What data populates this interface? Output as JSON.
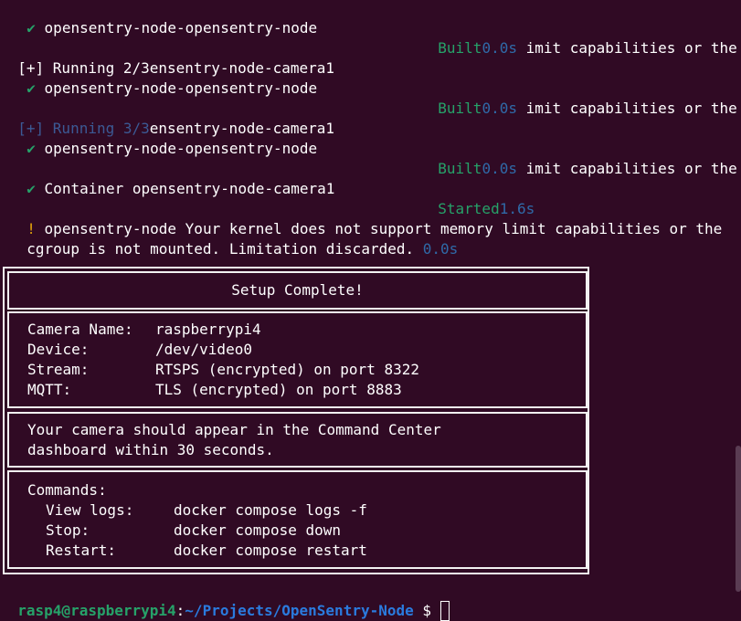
{
  "terminal": {
    "lines": [
      {
        "check": "✔",
        "text": "opensentry-node-opensentry-node"
      },
      {
        "built": "Built",
        "time": "0.0s",
        "tail": "imit capabilities or the"
      },
      {
        "prefix": "[+] Running 2/3",
        "text": "ensentry-node-camera1"
      },
      {
        "check": "✔",
        "text": "opensentry-node-opensentry-node"
      },
      {
        "built": "Built",
        "time": "0.0s",
        "tail": "imit capabilities or the"
      },
      {
        "prefix": "[+] Running 3/3",
        "text": "ensentry-node-camera1"
      },
      {
        "check": "✔",
        "text": "opensentry-node-opensentry-node"
      },
      {
        "built": "Built",
        "time": "0.0s",
        "tail": "imit capabilities or the"
      },
      {
        "check": "✔",
        "text": "Container opensentry-node-camera1"
      },
      {
        "started": "Started",
        "time": "1.6s"
      },
      {
        "warn": "!",
        "text": "opensentry-node Your kernel does not support memory limit capabilities or the"
      },
      {
        "text": "cgroup is not mounted. Limitation discarded.",
        "time": "0.0s"
      }
    ]
  },
  "setup_box": {
    "title": "Setup Complete!",
    "info": [
      {
        "label": "Camera Name:",
        "value": "raspberrypi4"
      },
      {
        "label": "Device:",
        "value": "/dev/video0"
      },
      {
        "label": "Stream:",
        "value": "RTSPS (encrypted) on port 8322"
      },
      {
        "label": "MQTT:",
        "value": "TLS (encrypted) on port 8883"
      }
    ],
    "message_line1": "Your camera should appear in the Command Center",
    "message_line2": "dashboard within 30 seconds.",
    "commands_title": "Commands:",
    "commands": [
      {
        "label": "View logs:",
        "value": "docker compose logs -f"
      },
      {
        "label": "Stop:",
        "value": "docker compose down"
      },
      {
        "label": "Restart:",
        "value": "docker compose restart"
      }
    ]
  },
  "prompt": {
    "user_host": "rasp4@raspberrypi4",
    "separator": ":",
    "path": "~/Projects/OpenSentry-Node",
    "symbol": "$"
  }
}
